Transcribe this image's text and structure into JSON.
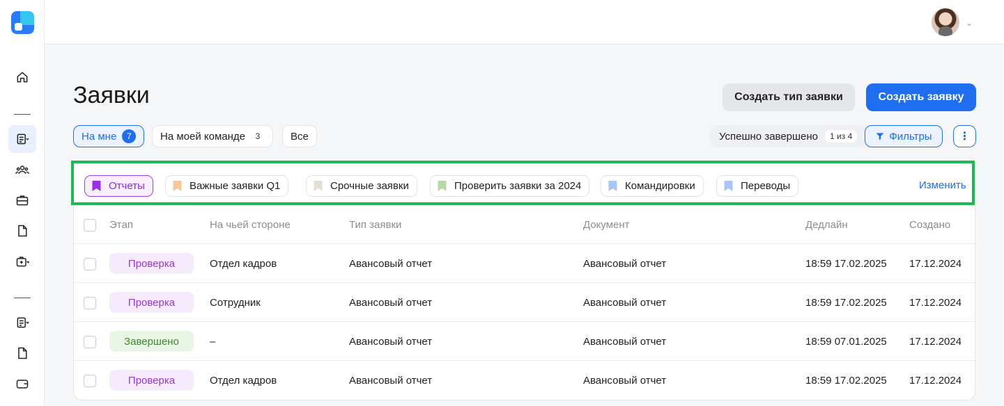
{
  "sidebar": {
    "items": [
      {
        "name": "home-icon"
      },
      {
        "name": "requests-icon",
        "active": true
      },
      {
        "name": "team-icon"
      },
      {
        "name": "briefcase-icon"
      },
      {
        "name": "document-icon"
      },
      {
        "name": "medkit-icon"
      },
      {
        "name": "list-icon"
      },
      {
        "name": "file-icon"
      },
      {
        "name": "wallet-icon"
      }
    ]
  },
  "header": {
    "title": "Заявки",
    "create_type_label": "Создать тип заявки",
    "create_label": "Создать заявку"
  },
  "tabs": [
    {
      "label": "На мне",
      "count": "7",
      "active": true
    },
    {
      "label": "На моей команде",
      "count": "3"
    },
    {
      "label": "Все",
      "count": ""
    }
  ],
  "status_filter": {
    "label": "Успешно завершено",
    "counter": "1 из 4"
  },
  "filters_label": "Фильтры",
  "more_icon": "more-vertical-icon",
  "saved_filters": {
    "items": [
      {
        "label": "Отчеты",
        "color": "#9b2ee6",
        "active": true
      },
      {
        "label": "Важные заявки Q1",
        "color": "#f6c79a"
      },
      {
        "label": "Срочные заявки",
        "color": "#e5ddd6"
      },
      {
        "label": "Проверить заявки за 2024",
        "color": "#b7d9a9"
      },
      {
        "label": "Командировки",
        "color": "#a9c4f5"
      },
      {
        "label": "Переводы",
        "color": "#a9c4f5"
      }
    ],
    "change_label": "Изменить",
    "highlight_color": "#1db954"
  },
  "table": {
    "columns": [
      "Этап",
      "На чьей стороне",
      "Тип заявки",
      "Документ",
      "Дедлайн",
      "Создано"
    ],
    "rows": [
      {
        "stage": "Проверка",
        "stage_kind": "review",
        "side": "Отдел кадров",
        "type": "Авансовый отчет",
        "document": "Авансовый отчет",
        "deadline": "18:59 17.02.2025",
        "created": "17.12.2024"
      },
      {
        "stage": "Проверка",
        "stage_kind": "review",
        "side": "Сотрудник",
        "type": "Авансовый отчет",
        "document": "Авансовый отчет",
        "deadline": "18:59 17.02.2025",
        "created": "17.12.2024"
      },
      {
        "stage": "Завершено",
        "stage_kind": "done",
        "side": "–",
        "type": "Авансовый отчет",
        "document": "Авансовый отчет",
        "deadline": "18:59 07.01.2025",
        "created": "17.12.2024"
      },
      {
        "stage": "Проверка",
        "stage_kind": "review",
        "side": "Отдел кадров",
        "type": "Авансовый отчет",
        "document": "Авансовый отчет",
        "deadline": "18:59 17.02.2025",
        "created": "17.12.2024"
      }
    ]
  },
  "colors": {
    "accent": "#1f6ef0",
    "review": "#9a35d8",
    "done": "#3c8a2c"
  }
}
